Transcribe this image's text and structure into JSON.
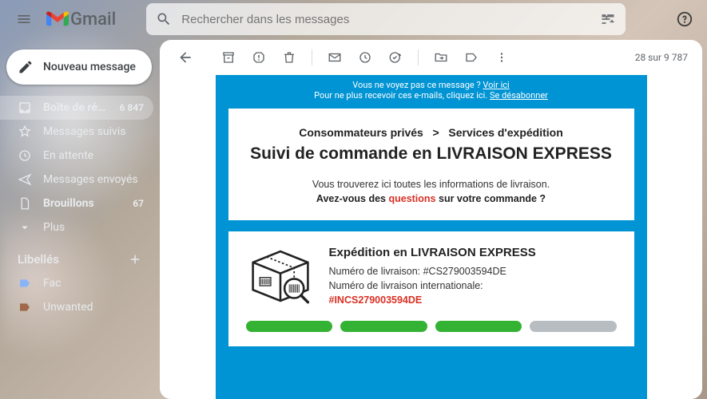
{
  "app": {
    "name": "Gmail"
  },
  "search": {
    "placeholder": "Rechercher dans les messages"
  },
  "compose": {
    "label": "Nouveau message"
  },
  "nav": {
    "inbox": {
      "label": "Boîte de récepti...",
      "count": "6 847"
    },
    "starred": {
      "label": "Messages suivis"
    },
    "snoozed": {
      "label": "En attente"
    },
    "sent": {
      "label": "Messages envoyés"
    },
    "drafts": {
      "label": "Brouillons",
      "count": "67"
    },
    "more": {
      "label": "Plus"
    }
  },
  "labels": {
    "header": "Libellés",
    "items": [
      {
        "label": "Fac"
      },
      {
        "label": "Unwanted"
      }
    ]
  },
  "toolbar": {
    "counter": "28 sur 9 787"
  },
  "email": {
    "preheader_view": "Vous ne voyez pas ce message ?",
    "preheader_view_link": "Voir ici",
    "preheader_unsub": "Pour ne plus recevoir ces e-mails, cliquez ici.",
    "preheader_unsub_link": "Se désabonner",
    "breadcrumb_left": "Consommateurs privés",
    "breadcrumb_sep": ">",
    "breadcrumb_right": "Services d'expédition",
    "headline": "Suivi de commande en LIVRAISON EXPRESS",
    "sub1": "Vous trouverez ici toutes les informations de livraison.",
    "sub2_pre": "Avez-vous des ",
    "sub2_red": "questions",
    "sub2_post": " sur votre commande ?",
    "ship_title": "Expédition en LIVRAISON EXPRESS",
    "ship_num_label": "Numéro de livraison: ",
    "ship_num": "#CS279003594DE",
    "ship_intl_label": "Numéro de livraison internationale:",
    "ship_intl_num": "#INCS279003594DE",
    "progress_done": 3,
    "progress_total": 4
  }
}
